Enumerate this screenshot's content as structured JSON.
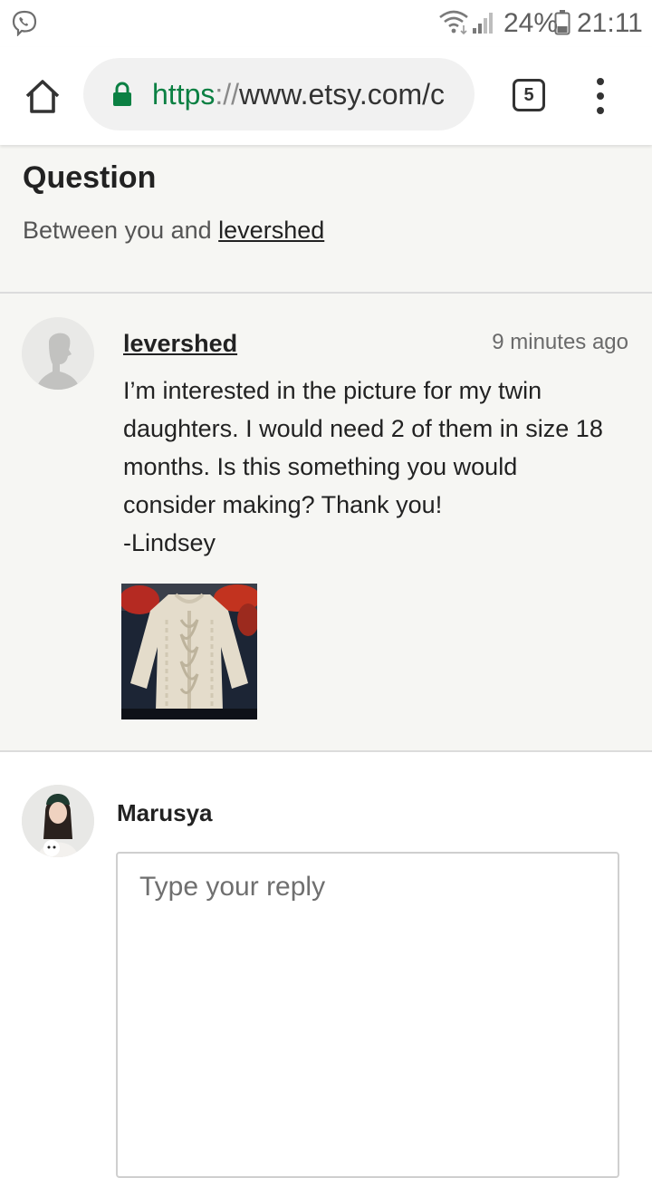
{
  "status_bar": {
    "battery": "24%",
    "time": "21:11",
    "icons": [
      "viber-icon",
      "wifi-icon",
      "signal-icon",
      "battery-icon"
    ]
  },
  "browser": {
    "url_scheme": "https",
    "url_sep": "://",
    "url_host": "www.etsy.com/c",
    "tab_count": "5",
    "icons": [
      "home-icon",
      "lock-icon",
      "tab-switcher-icon",
      "overflow-menu-icon"
    ],
    "colors": {
      "secure": "#0b8043"
    }
  },
  "question": {
    "title": "Question",
    "subtitle_prefix": "Between you and ",
    "subtitle_user": "levershed"
  },
  "message": {
    "author": "levershed",
    "time": "9 minutes ago",
    "body_lines": [
      "I’m interested in the picture for my twin",
      "daughters. I would need 2 of them in size 18",
      "months. Is this something you would",
      "consider making? Thank you!",
      "-Lindsey"
    ],
    "attachment": "knitted-sweater-photo"
  },
  "reply": {
    "user": "Marusya",
    "placeholder": "Type your reply"
  }
}
